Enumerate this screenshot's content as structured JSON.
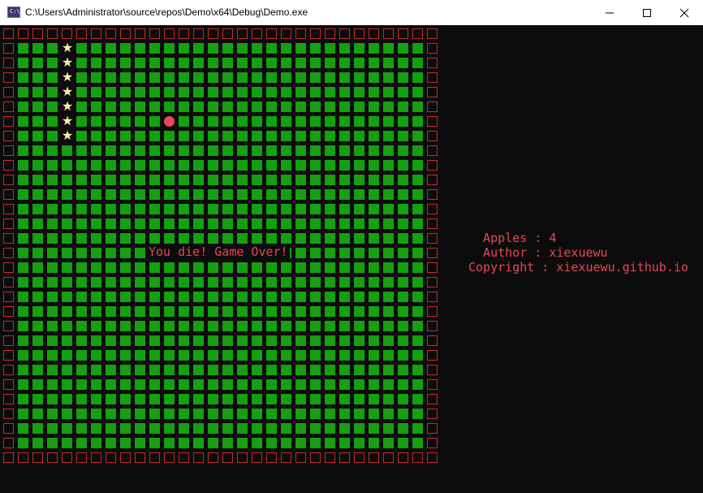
{
  "window": {
    "title": "C:\\Users\\Administrator\\source\\repos\\Demo\\x64\\Debug\\Demo.exe",
    "icon": "console-app-icon",
    "controls": [
      "minimize-icon",
      "maximize-icon",
      "close-icon"
    ]
  },
  "game": {
    "grid_cols": 30,
    "grid_rows": 30,
    "snake": [
      [
        4,
        1
      ],
      [
        4,
        2
      ],
      [
        4,
        3
      ],
      [
        4,
        4
      ],
      [
        4,
        5
      ],
      [
        4,
        6
      ],
      [
        4,
        7
      ]
    ],
    "apple": [
      11,
      6
    ],
    "colors": {
      "wall": "#c8292c",
      "grass": "#13a10e",
      "snake": "#f9f1a5",
      "apple": "#e74856",
      "text": "#e74856",
      "background": "#0c0c0c"
    },
    "message": "You die! Game Over!"
  },
  "info": {
    "apples_line": "  Apples : 4",
    "author_line": "  Author : xiexuewu",
    "copyright_line": "Copyright : xiexuewu.github.io"
  }
}
